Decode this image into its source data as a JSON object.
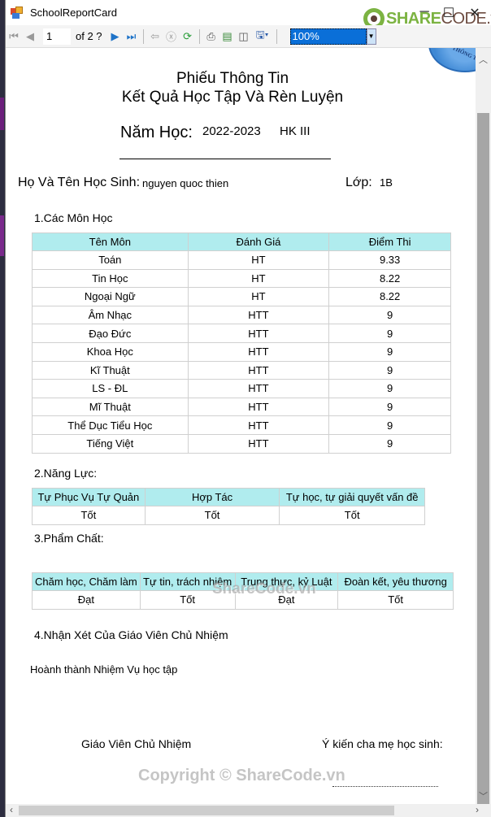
{
  "window": {
    "title": "SchoolReportCard",
    "controls": [
      "minimize",
      "maximize",
      "close"
    ]
  },
  "brand": {
    "name_green": "SHARE",
    "name_brown": "CODE.vn"
  },
  "toolbar": {
    "current_page": "1",
    "page_total": "of  2 ?",
    "zoom": "100%"
  },
  "report": {
    "title_line1": "Phiếu Thông Tin",
    "title_line2": "Kết Quả Học Tập Và Rèn Luyện",
    "year_label": "Năm Học:",
    "year_value": "2022-2023",
    "term_value": "HK III",
    "student_label": "Họ Và Tên Học Sinh:",
    "student_value": "nguyen quoc thien",
    "class_label": "Lớp:",
    "class_value": "1B",
    "seal_text": "PHỔ THÔNG TH",
    "section1": "1.Các Môn Học",
    "subjects": {
      "headers": [
        "Tên Môn",
        "Đánh Giá",
        "Điểm Thi"
      ],
      "rows": [
        [
          "Toán",
          "HT",
          "9.33"
        ],
        [
          "Tin Học",
          "HT",
          "8.22"
        ],
        [
          "Ngoại Ngữ",
          "HT",
          "8.22"
        ],
        [
          "Âm Nhạc",
          "HTT",
          "9"
        ],
        [
          "Đạo Đức",
          "HTT",
          "9"
        ],
        [
          "Khoa Học",
          "HTT",
          "9"
        ],
        [
          "Kĩ Thuật",
          "HTT",
          "9"
        ],
        [
          "LS - ĐL",
          "HTT",
          "9"
        ],
        [
          "Mĩ Thuật",
          "HTT",
          "9"
        ],
        [
          "Thể Dục Tiểu Học",
          "HTT",
          "9"
        ],
        [
          "Tiếng Việt",
          "HTT",
          "9"
        ]
      ]
    },
    "section2": "2.Năng Lực:",
    "competencies": {
      "headers": [
        "Tự Phục Vụ Tự Quản",
        "Hợp Tác",
        "Tự học, tự giải quyết vấn đề"
      ],
      "values": [
        "Tốt",
        "Tốt",
        "Tốt"
      ]
    },
    "section3": "3.Phẩm Chất:",
    "qualities": {
      "headers": [
        "Chăm học, Chăm làm",
        "Tự tin, trách nhiệm",
        "Trung thực, kỷ Luật",
        "Đoàn kết, yêu thương"
      ],
      "values": [
        "Đạt",
        "Tốt",
        "Đạt",
        "Tốt"
      ]
    },
    "section4": "4.Nhận Xét Của Giáo Viên Chủ Nhiệm",
    "comment": "Hoành thành Nhiệm Vụ học tập",
    "sign_teacher": "Giáo Viên Chủ Nhiệm",
    "sign_parent": "Ý kiến cha mẹ học sinh:"
  },
  "watermarks": {
    "center": "ShareCode.vn",
    "footer": "Copyright © ShareCode.vn"
  }
}
